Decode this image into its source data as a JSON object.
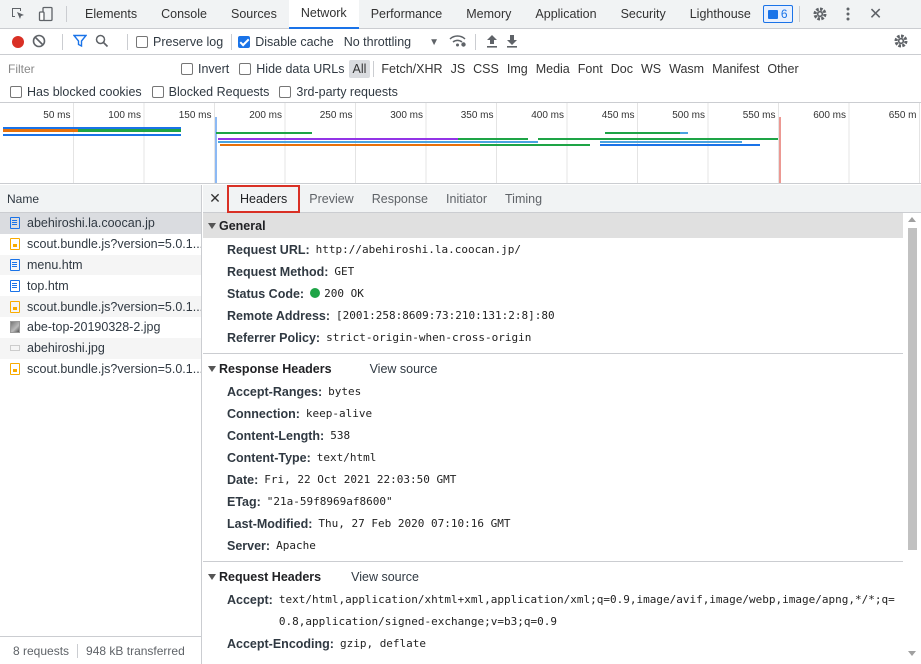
{
  "topbar": {
    "tabs": [
      "Elements",
      "Console",
      "Sources",
      "Network",
      "Performance",
      "Memory",
      "Application",
      "Security",
      "Lighthouse"
    ],
    "active_tab": "Network",
    "issues_count": "6"
  },
  "toolbar": {
    "preserve_log": "Preserve log",
    "disable_cache": "Disable cache",
    "throttling": "No throttling"
  },
  "filter": {
    "placeholder": "Filter",
    "invert": "Invert",
    "hide_data_urls": "Hide data URLs",
    "types": [
      "All",
      "Fetch/XHR",
      "JS",
      "CSS",
      "Img",
      "Media",
      "Font",
      "Doc",
      "WS",
      "Wasm",
      "Manifest",
      "Other"
    ],
    "has_blocked_cookies": "Has blocked cookies",
    "blocked_requests": "Blocked Requests",
    "third_party": "3rd-party requests"
  },
  "overview": {
    "ticks": [
      "50 ms",
      "100 ms",
      "150 ms",
      "200 ms",
      "250 ms",
      "300 ms",
      "350 ms",
      "400 ms",
      "450 ms",
      "500 ms",
      "550 ms",
      "600 ms",
      "650 m"
    ]
  },
  "requests": {
    "header": "Name",
    "items": [
      {
        "name": "abehiroshi.la.coocan.jp",
        "type": "doc"
      },
      {
        "name": "scout.bundle.js?version=5.0.1...",
        "type": "js"
      },
      {
        "name": "menu.htm",
        "type": "doc"
      },
      {
        "name": "top.htm",
        "type": "doc"
      },
      {
        "name": "scout.bundle.js?version=5.0.1...",
        "type": "js"
      },
      {
        "name": "abe-top-20190328-2.jpg",
        "type": "img"
      },
      {
        "name": "abehiroshi.jpg",
        "type": "blank"
      },
      {
        "name": "scout.bundle.js?version=5.0.1...",
        "type": "js"
      }
    ],
    "count": "8 requests",
    "transferred": "948 kB transferred"
  },
  "detail": {
    "tabs": [
      "Headers",
      "Preview",
      "Response",
      "Initiator",
      "Timing"
    ],
    "active_tab": "Headers",
    "general": {
      "title": "General",
      "rows": [
        {
          "k": "Request URL:",
          "v": "http://abehiroshi.la.coocan.jp/"
        },
        {
          "k": "Request Method:",
          "v": "GET"
        },
        {
          "k": "Status Code:",
          "v": "200 OK"
        },
        {
          "k": "Remote Address:",
          "v": "[2001:258:8609:73:210:131:2:8]:80"
        },
        {
          "k": "Referrer Policy:",
          "v": "strict-origin-when-cross-origin"
        }
      ]
    },
    "response_headers": {
      "title": "Response Headers",
      "view_source": "View source",
      "rows": [
        {
          "k": "Accept-Ranges:",
          "v": "bytes"
        },
        {
          "k": "Connection:",
          "v": "keep-alive"
        },
        {
          "k": "Content-Length:",
          "v": "538"
        },
        {
          "k": "Content-Type:",
          "v": "text/html"
        },
        {
          "k": "Date:",
          "v": "Fri, 22 Oct 2021 22:03:50 GMT"
        },
        {
          "k": "ETag:",
          "v": "\"21a-59f8969af8600\""
        },
        {
          "k": "Last-Modified:",
          "v": "Thu, 27 Feb 2020 07:10:16 GMT"
        },
        {
          "k": "Server:",
          "v": "Apache"
        }
      ]
    },
    "request_headers": {
      "title": "Request Headers",
      "view_source": "View source",
      "rows": [
        {
          "k": "Accept:",
          "v": "text/html,application/xhtml+xml,application/xml;q=0.9,image/avif,image/webp,image/apng,*/*;q=0.8,application/signed-exchange;v=b3;q=0.9"
        },
        {
          "k": "Accept-Encoding:",
          "v": "gzip, deflate"
        }
      ]
    }
  }
}
